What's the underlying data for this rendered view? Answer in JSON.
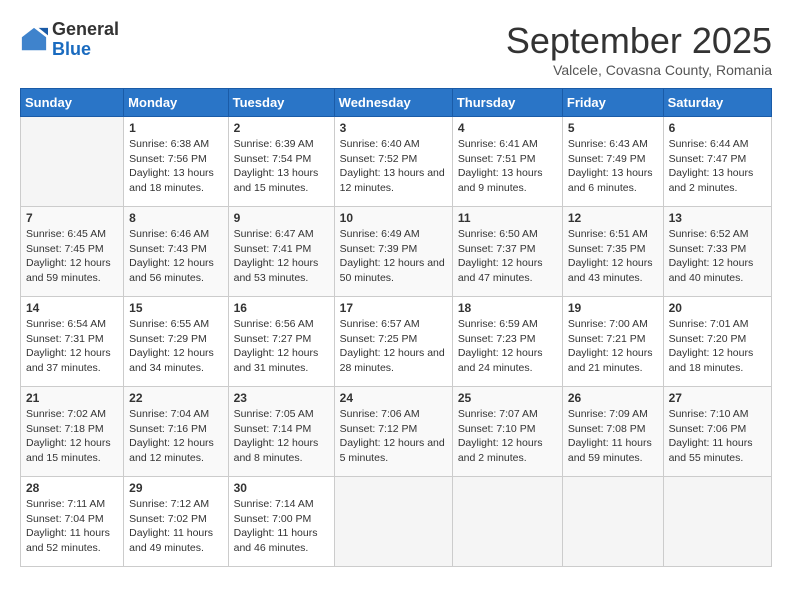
{
  "header": {
    "logo_general": "General",
    "logo_blue": "Blue",
    "month_title": "September 2025",
    "subtitle": "Valcele, Covasna County, Romania"
  },
  "days_of_week": [
    "Sunday",
    "Monday",
    "Tuesday",
    "Wednesday",
    "Thursday",
    "Friday",
    "Saturday"
  ],
  "weeks": [
    [
      {
        "day": "",
        "sunrise": "",
        "sunset": "",
        "daylight": ""
      },
      {
        "day": "1",
        "sunrise": "Sunrise: 6:38 AM",
        "sunset": "Sunset: 7:56 PM",
        "daylight": "Daylight: 13 hours and 18 minutes."
      },
      {
        "day": "2",
        "sunrise": "Sunrise: 6:39 AM",
        "sunset": "Sunset: 7:54 PM",
        "daylight": "Daylight: 13 hours and 15 minutes."
      },
      {
        "day": "3",
        "sunrise": "Sunrise: 6:40 AM",
        "sunset": "Sunset: 7:52 PM",
        "daylight": "Daylight: 13 hours and 12 minutes."
      },
      {
        "day": "4",
        "sunrise": "Sunrise: 6:41 AM",
        "sunset": "Sunset: 7:51 PM",
        "daylight": "Daylight: 13 hours and 9 minutes."
      },
      {
        "day": "5",
        "sunrise": "Sunrise: 6:43 AM",
        "sunset": "Sunset: 7:49 PM",
        "daylight": "Daylight: 13 hours and 6 minutes."
      },
      {
        "day": "6",
        "sunrise": "Sunrise: 6:44 AM",
        "sunset": "Sunset: 7:47 PM",
        "daylight": "Daylight: 13 hours and 2 minutes."
      }
    ],
    [
      {
        "day": "7",
        "sunrise": "Sunrise: 6:45 AM",
        "sunset": "Sunset: 7:45 PM",
        "daylight": "Daylight: 12 hours and 59 minutes."
      },
      {
        "day": "8",
        "sunrise": "Sunrise: 6:46 AM",
        "sunset": "Sunset: 7:43 PM",
        "daylight": "Daylight: 12 hours and 56 minutes."
      },
      {
        "day": "9",
        "sunrise": "Sunrise: 6:47 AM",
        "sunset": "Sunset: 7:41 PM",
        "daylight": "Daylight: 12 hours and 53 minutes."
      },
      {
        "day": "10",
        "sunrise": "Sunrise: 6:49 AM",
        "sunset": "Sunset: 7:39 PM",
        "daylight": "Daylight: 12 hours and 50 minutes."
      },
      {
        "day": "11",
        "sunrise": "Sunrise: 6:50 AM",
        "sunset": "Sunset: 7:37 PM",
        "daylight": "Daylight: 12 hours and 47 minutes."
      },
      {
        "day": "12",
        "sunrise": "Sunrise: 6:51 AM",
        "sunset": "Sunset: 7:35 PM",
        "daylight": "Daylight: 12 hours and 43 minutes."
      },
      {
        "day": "13",
        "sunrise": "Sunrise: 6:52 AM",
        "sunset": "Sunset: 7:33 PM",
        "daylight": "Daylight: 12 hours and 40 minutes."
      }
    ],
    [
      {
        "day": "14",
        "sunrise": "Sunrise: 6:54 AM",
        "sunset": "Sunset: 7:31 PM",
        "daylight": "Daylight: 12 hours and 37 minutes."
      },
      {
        "day": "15",
        "sunrise": "Sunrise: 6:55 AM",
        "sunset": "Sunset: 7:29 PM",
        "daylight": "Daylight: 12 hours and 34 minutes."
      },
      {
        "day": "16",
        "sunrise": "Sunrise: 6:56 AM",
        "sunset": "Sunset: 7:27 PM",
        "daylight": "Daylight: 12 hours and 31 minutes."
      },
      {
        "day": "17",
        "sunrise": "Sunrise: 6:57 AM",
        "sunset": "Sunset: 7:25 PM",
        "daylight": "Daylight: 12 hours and 28 minutes."
      },
      {
        "day": "18",
        "sunrise": "Sunrise: 6:59 AM",
        "sunset": "Sunset: 7:23 PM",
        "daylight": "Daylight: 12 hours and 24 minutes."
      },
      {
        "day": "19",
        "sunrise": "Sunrise: 7:00 AM",
        "sunset": "Sunset: 7:21 PM",
        "daylight": "Daylight: 12 hours and 21 minutes."
      },
      {
        "day": "20",
        "sunrise": "Sunrise: 7:01 AM",
        "sunset": "Sunset: 7:20 PM",
        "daylight": "Daylight: 12 hours and 18 minutes."
      }
    ],
    [
      {
        "day": "21",
        "sunrise": "Sunrise: 7:02 AM",
        "sunset": "Sunset: 7:18 PM",
        "daylight": "Daylight: 12 hours and 15 minutes."
      },
      {
        "day": "22",
        "sunrise": "Sunrise: 7:04 AM",
        "sunset": "Sunset: 7:16 PM",
        "daylight": "Daylight: 12 hours and 12 minutes."
      },
      {
        "day": "23",
        "sunrise": "Sunrise: 7:05 AM",
        "sunset": "Sunset: 7:14 PM",
        "daylight": "Daylight: 12 hours and 8 minutes."
      },
      {
        "day": "24",
        "sunrise": "Sunrise: 7:06 AM",
        "sunset": "Sunset: 7:12 PM",
        "daylight": "Daylight: 12 hours and 5 minutes."
      },
      {
        "day": "25",
        "sunrise": "Sunrise: 7:07 AM",
        "sunset": "Sunset: 7:10 PM",
        "daylight": "Daylight: 12 hours and 2 minutes."
      },
      {
        "day": "26",
        "sunrise": "Sunrise: 7:09 AM",
        "sunset": "Sunset: 7:08 PM",
        "daylight": "Daylight: 11 hours and 59 minutes."
      },
      {
        "day": "27",
        "sunrise": "Sunrise: 7:10 AM",
        "sunset": "Sunset: 7:06 PM",
        "daylight": "Daylight: 11 hours and 55 minutes."
      }
    ],
    [
      {
        "day": "28",
        "sunrise": "Sunrise: 7:11 AM",
        "sunset": "Sunset: 7:04 PM",
        "daylight": "Daylight: 11 hours and 52 minutes."
      },
      {
        "day": "29",
        "sunrise": "Sunrise: 7:12 AM",
        "sunset": "Sunset: 7:02 PM",
        "daylight": "Daylight: 11 hours and 49 minutes."
      },
      {
        "day": "30",
        "sunrise": "Sunrise: 7:14 AM",
        "sunset": "Sunset: 7:00 PM",
        "daylight": "Daylight: 11 hours and 46 minutes."
      },
      {
        "day": "",
        "sunrise": "",
        "sunset": "",
        "daylight": ""
      },
      {
        "day": "",
        "sunrise": "",
        "sunset": "",
        "daylight": ""
      },
      {
        "day": "",
        "sunrise": "",
        "sunset": "",
        "daylight": ""
      },
      {
        "day": "",
        "sunrise": "",
        "sunset": "",
        "daylight": ""
      }
    ]
  ]
}
